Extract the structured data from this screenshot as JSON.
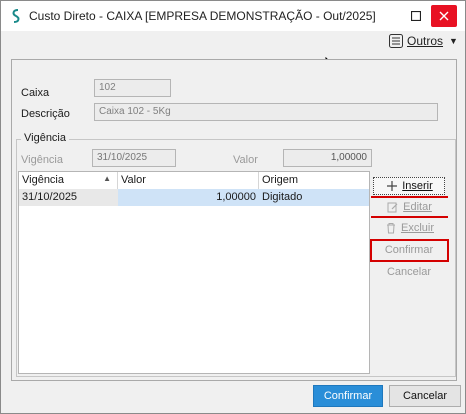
{
  "window": {
    "title": "Custo Direto - CAIXA [EMPRESA DEMONSTRAÇÃO - Out/2025]",
    "close_color": "#e81123"
  },
  "toolbar": {
    "outros_label": "Outros"
  },
  "form": {
    "caixa_label": "Caixa",
    "caixa_value": "102",
    "descricao_label": "Descrição",
    "descricao_value": "Caixa 102 - 5Kg"
  },
  "vigencia_group": {
    "title": "Vigência",
    "vigencia_label": "Vigência",
    "vigencia_value": "31/10/2025",
    "valor_label": "Valor",
    "valor_value": "1,00000"
  },
  "grid": {
    "columns": [
      "Vigência",
      "Valor",
      "Origem"
    ],
    "rows": [
      [
        "31/10/2025",
        "1,00000",
        "Digitado"
      ]
    ]
  },
  "side_buttons": {
    "inserir": "Inserir",
    "editar": "Editar",
    "excluir": "Excluir",
    "confirmar": "Confirmar",
    "cancelar": "Cancelar"
  },
  "footer": {
    "confirmar": "Confirmar",
    "cancelar": "Cancelar",
    "accent": "#2a8ed8"
  },
  "annotation_color": "#d40000"
}
